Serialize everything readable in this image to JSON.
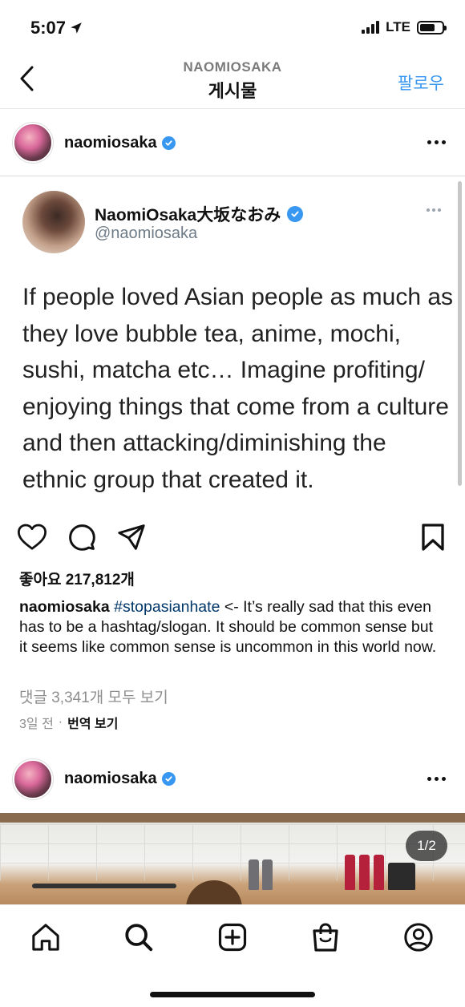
{
  "status": {
    "time": "5:07",
    "network": "LTE"
  },
  "nav": {
    "subtitle": "NAOMIOSAKA",
    "title": "게시물",
    "follow_label": "팔로우"
  },
  "post": {
    "username": "naomiosaka",
    "tweet": {
      "display_name": "NaomiOsaka大坂なおみ",
      "handle": "@naomiosaka",
      "text": "If people loved Asian people as much as they love bubble tea, anime, mochi, sushi, matcha etc… Imagine profiting/ enjoying things that come from a culture and then attacking/diminishing the ethnic group that created it."
    },
    "likes": "좋아요 217,812개",
    "caption": {
      "user": "naomiosaka",
      "hashtag": "#stopasianhate",
      "text": " <- It’s really sad that this even has to be a hashtag/slogan. It should be common sense but it seems like common sense is uncommon in this world now."
    },
    "comments_link": "댓글 3,341개 모두 보기",
    "time_ago": "3일 전",
    "separator": "·",
    "translate_label": "번역 보기"
  },
  "post2": {
    "username": "naomiosaka",
    "counter": "1/2"
  },
  "icons": {
    "back": "chevron-left-icon",
    "verified": "verified-badge-icon",
    "more": "more-horizontal-icon",
    "like": "heart-icon",
    "comment": "comment-icon",
    "share": "send-icon",
    "save": "bookmark-icon",
    "tabs": [
      "home-icon",
      "search-icon",
      "add-post-icon",
      "shop-icon",
      "profile-icon"
    ]
  },
  "colors": {
    "link_blue": "#3897f0",
    "hashtag": "#00376b",
    "muted": "#8e8e8e",
    "verified": "#3897f0"
  }
}
